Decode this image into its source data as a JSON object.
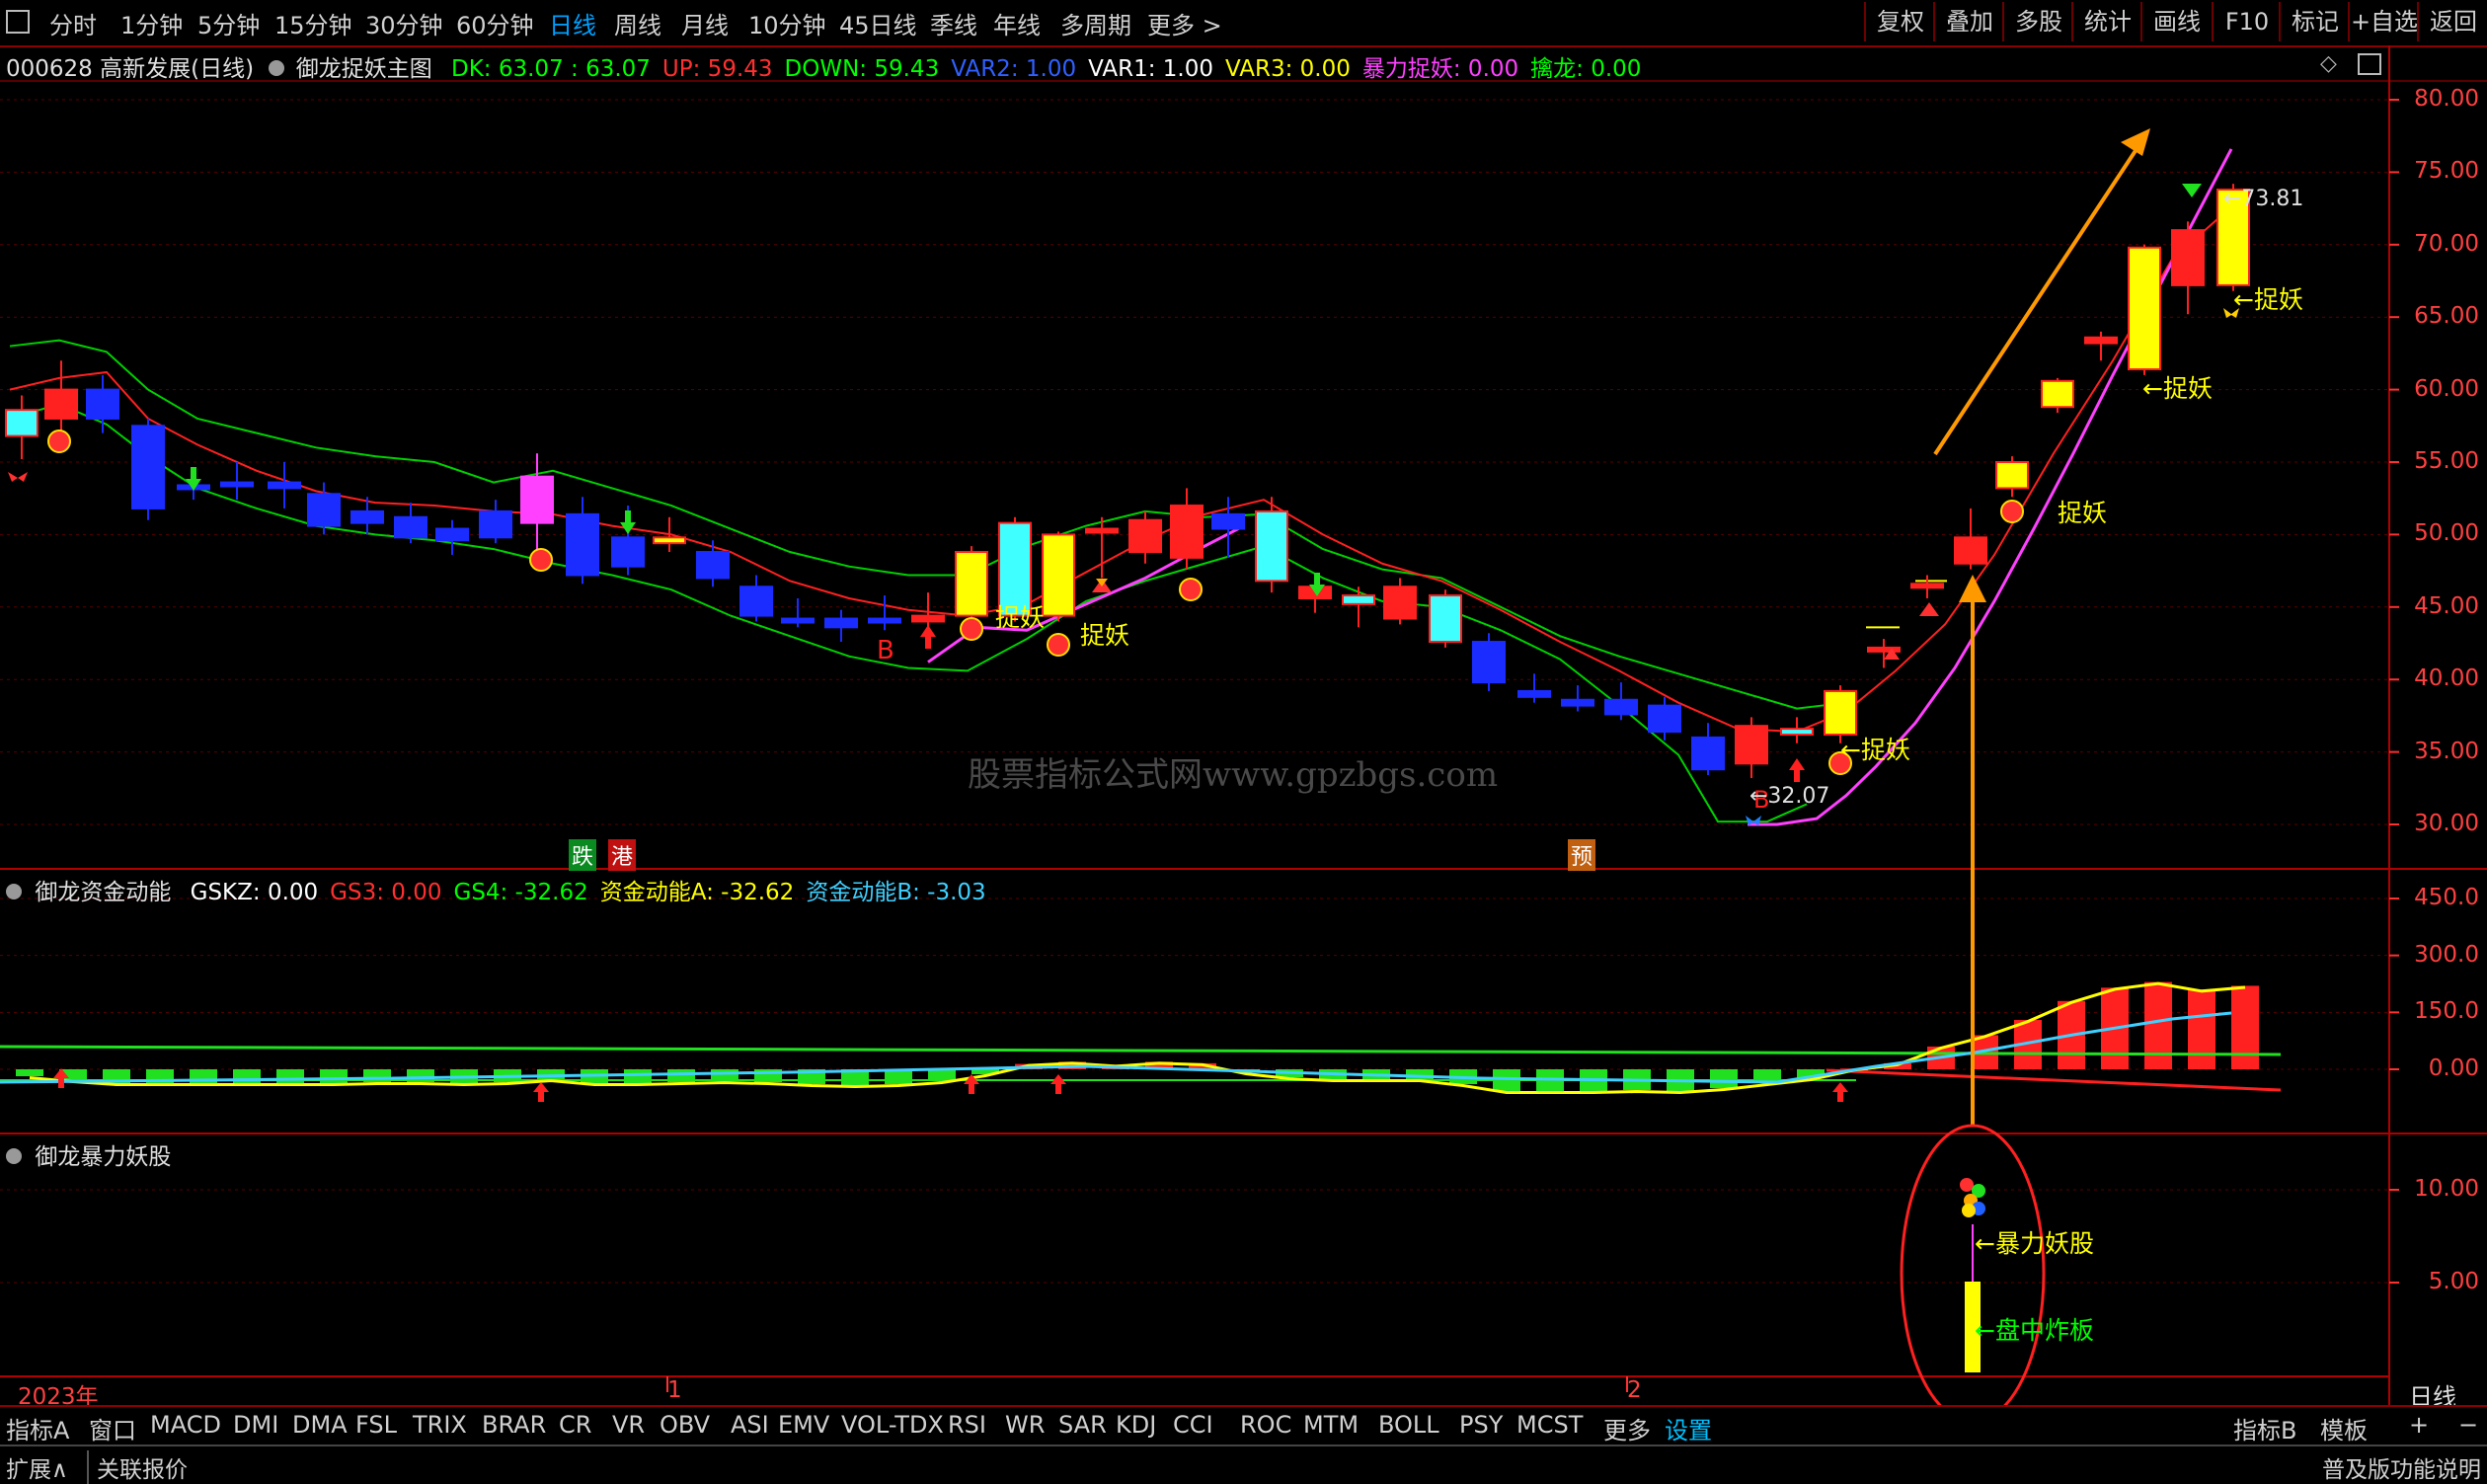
{
  "periods": [
    {
      "label": "分时"
    },
    {
      "label": "1分钟"
    },
    {
      "label": "5分钟"
    },
    {
      "label": "15分钟"
    },
    {
      "label": "30分钟"
    },
    {
      "label": "60分钟"
    },
    {
      "label": "日线",
      "active": true
    },
    {
      "label": "周线"
    },
    {
      "label": "月线"
    },
    {
      "label": "10分钟"
    },
    {
      "label": "45日线"
    },
    {
      "label": "季线"
    },
    {
      "label": "年线"
    },
    {
      "label": "多周期"
    },
    {
      "label": "更多 >"
    }
  ],
  "right_tools": [
    "复权",
    "叠加",
    "多股",
    "统计",
    "画线",
    "F10",
    "标记",
    "+自选",
    "返回"
  ],
  "main_header": {
    "stock": "000628 高新发展(日线)",
    "indicator": "御龙捉妖主图",
    "items": [
      {
        "text": "DK: 63.07 : 63.07",
        "color": "#00ff00"
      },
      {
        "text": "UP: 59.43",
        "color": "#ff3030"
      },
      {
        "text": "DOWN: 59.43",
        "color": "#00ff00"
      },
      {
        "text": "VAR2: 1.00",
        "color": "#3060ff"
      },
      {
        "text": "VAR1: 1.00",
        "color": "#ffffff"
      },
      {
        "text": "VAR3: 0.00",
        "color": "#ffff00"
      },
      {
        "text": "暴力捉妖: 0.00",
        "color": "#ff40ff"
      },
      {
        "text": "擒龙: 0.00",
        "color": "#00ff00"
      }
    ]
  },
  "sub1_header": {
    "indicator": "御龙资金动能",
    "items": [
      {
        "text": "GSKZ: 0.00",
        "color": "#ffffff"
      },
      {
        "text": "GS3: 0.00",
        "color": "#ff3030"
      },
      {
        "text": "GS4: -32.62",
        "color": "#00ff00"
      },
      {
        "text": "资金动能A: -32.62",
        "color": "#ffff00"
      },
      {
        "text": "资金动能B: -3.03",
        "color": "#40d0ff"
      }
    ]
  },
  "sub2_header": {
    "indicator": "御龙暴力妖股"
  },
  "axes": {
    "main": [
      "80.00",
      "75.00",
      "70.00",
      "65.00",
      "60.00",
      "55.00",
      "50.00",
      "45.00",
      "40.00",
      "35.00",
      "30.00"
    ],
    "sub1": [
      "450.0",
      "300.0",
      "150.0",
      "0.00"
    ],
    "sub2": [
      "10.00",
      "5.00"
    ]
  },
  "annotations": {
    "tz1": "捉妖",
    "tz2": "捉妖",
    "tz3": "←捉妖",
    "tz4": "捉妖",
    "tz5": "←捉妖",
    "tz6": "←捉妖",
    "low_price": "←32.07",
    "high_price": "←73.81",
    "die": "跌",
    "gang": "港",
    "yu": "预",
    "b1": "B",
    "b2": "B",
    "baoli": "←暴力妖股",
    "zhaban": "←盘中炸板"
  },
  "watermark": "股票指标公式网www.gpzbgs.com",
  "time_axis": {
    "year": "2023年",
    "m1": "1",
    "m2": "2",
    "period": "日线"
  },
  "bottom_tabs": [
    "指标A",
    "窗口",
    "MACD",
    "DMI",
    "DMA",
    "FSL",
    "TRIX",
    "BRAR",
    "CR",
    "VR",
    "OBV",
    "ASI",
    "EMV",
    "VOL-TDX",
    "RSI",
    "WR",
    "SAR",
    "KDJ",
    "CCI",
    "ROC",
    "MTM",
    "BOLL",
    "PSY",
    "MCST",
    "更多",
    "设置"
  ],
  "bottom_right": [
    "指标B",
    "模板",
    "+",
    "−"
  ],
  "status": {
    "left1": "扩展∧",
    "left2": "关联报价",
    "right": "普及版功能说明"
  }
}
